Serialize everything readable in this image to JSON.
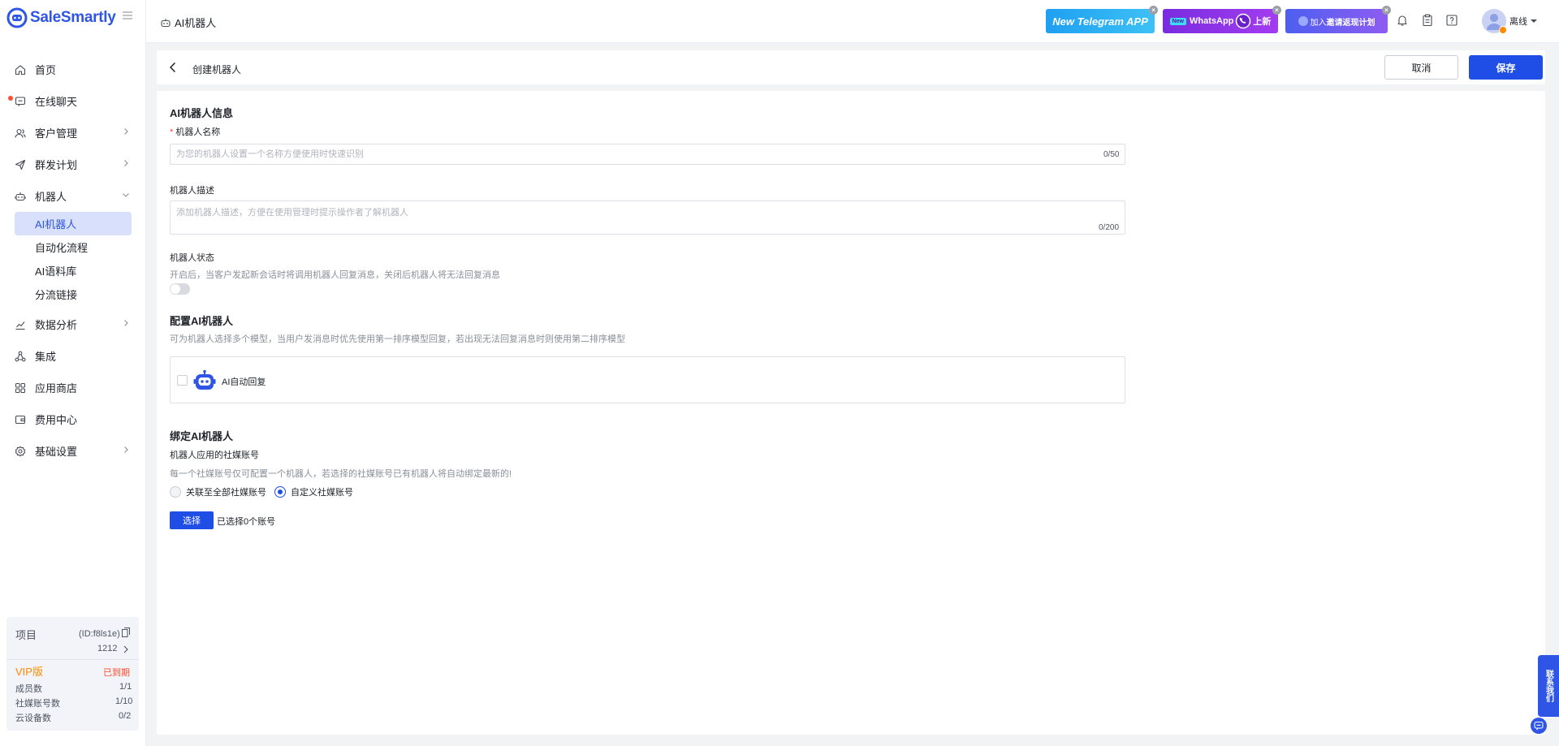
{
  "brand": {
    "name": "SaleSmartly",
    "color": "#2e55e6"
  },
  "sidebar": {
    "items": [
      {
        "label": "首页",
        "icon": "home-icon"
      },
      {
        "label": "在线聊天",
        "icon": "chat-icon",
        "has_dot": true
      },
      {
        "label": "客户管理",
        "icon": "users-icon",
        "expandable": true
      },
      {
        "label": "群发计划",
        "icon": "send-icon",
        "expandable": true
      },
      {
        "label": "机器人",
        "icon": "robot-icon",
        "expanded": true
      },
      {
        "label": "数据分析",
        "icon": "chart-icon",
        "expandable": true
      },
      {
        "label": "集成",
        "icon": "integration-icon"
      },
      {
        "label": "应用商店",
        "icon": "apps-icon"
      },
      {
        "label": "费用中心",
        "icon": "wallet-icon"
      },
      {
        "label": "基础设置",
        "icon": "settings-icon",
        "expandable": true
      }
    ],
    "robot_sub": [
      {
        "label": "AI机器人",
        "active": true
      },
      {
        "label": "自动化流程"
      },
      {
        "label": "AI语料库"
      },
      {
        "label": "分流链接"
      }
    ],
    "project": {
      "label": "项目",
      "id": "(ID:f8ls1e)",
      "name": "1212",
      "plan": "VIP版",
      "plan_status": "已到期",
      "stats": [
        {
          "label": "成员数",
          "value": "1/1"
        },
        {
          "label": "社媒账号数",
          "value": "1/10"
        },
        {
          "label": "云设备数",
          "value": "0/2"
        }
      ]
    }
  },
  "topbar": {
    "page_title": "AI机器人",
    "promos": {
      "telegram": "New Telegram APP",
      "whatsapp_badge": "New",
      "whatsapp": "WhatsApp",
      "whatsapp_suffix": "上新",
      "invite_prefix": "加入",
      "invite": "邀请返现计划"
    },
    "user_status": "离线"
  },
  "header": {
    "title": "创建机器人",
    "cancel": "取消",
    "save": "保存"
  },
  "form": {
    "info_title": "AI机器人信息",
    "name_label": "机器人名称",
    "name_required": "*",
    "name_placeholder": "为您的机器人设置一个名称方便使用时快速识别",
    "name_counter": "0/50",
    "desc_label": "机器人描述",
    "desc_placeholder": "添加机器人描述，方便在使用管理时提示操作者了解机器人",
    "desc_counter": "0/200",
    "status_label": "机器人状态",
    "status_hint": "开启后，当客户发起新会话时将调用机器人回复消息，关闭后机器人将无法回复消息",
    "status_on": false,
    "config_title": "配置AI机器人",
    "config_hint": "可为机器人选择多个模型，当用户发消息时优先使用第一排序模型回复，若出现无法回复消息时则使用第二排序模型",
    "model_name": "AI自动回复",
    "bind_title": "绑定AI机器人",
    "bind_label": "机器人应用的社媒账号",
    "bind_hint": "每一个社媒账号仅可配置一个机器人，若选择的社媒账号已有机器人将自动绑定最新的!",
    "radio_all": "关联至全部社媒账号",
    "radio_custom": "自定义社媒账号",
    "select_button": "选择",
    "selected_text": "已选择0个账号"
  },
  "float": {
    "side_label": "联系我们"
  },
  "colors": {
    "primary": "#1f4ee6",
    "danger": "#ff4d2e",
    "vip": "#ff8a00"
  }
}
